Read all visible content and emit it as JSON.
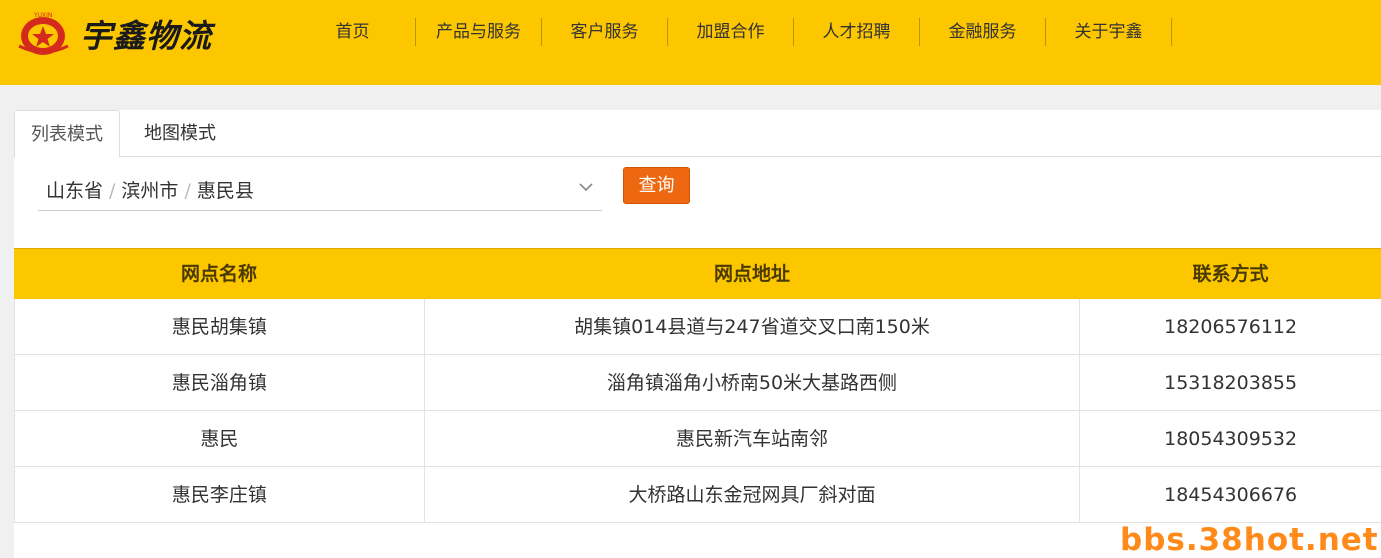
{
  "header": {
    "logo_text": "宇鑫物流",
    "logo_small": "YUXIN",
    "nav": [
      "首页",
      "产品与服务",
      "客户服务",
      "加盟合作",
      "人才招聘",
      "金融服务",
      "关于宇鑫"
    ]
  },
  "tabs": [
    "列表模式",
    "地图模式"
  ],
  "region": {
    "province": "山东省",
    "city": "滨州市",
    "county": "惠民县",
    "separator": "/"
  },
  "query_label": "查询",
  "table": {
    "headers": [
      "网点名称",
      "网点地址",
      "联系方式"
    ],
    "rows": [
      [
        "惠民胡集镇",
        "胡集镇014县道与247省道交叉口南150米",
        "18206576112"
      ],
      [
        "惠民淄角镇",
        "淄角镇淄角小桥南50米大基路西侧",
        "15318203855"
      ],
      [
        "惠民",
        "惠民新汽车站南邻",
        "18054309532"
      ],
      [
        "惠民李庄镇",
        "大桥路山东金冠网具厂斜对面",
        "18454306676"
      ]
    ]
  },
  "watermark": "bbs.38hot.net",
  "colors": {
    "brand_yellow": "#fdc700",
    "query_orange": "#ee6711",
    "watermark": "#ff8a1a"
  }
}
